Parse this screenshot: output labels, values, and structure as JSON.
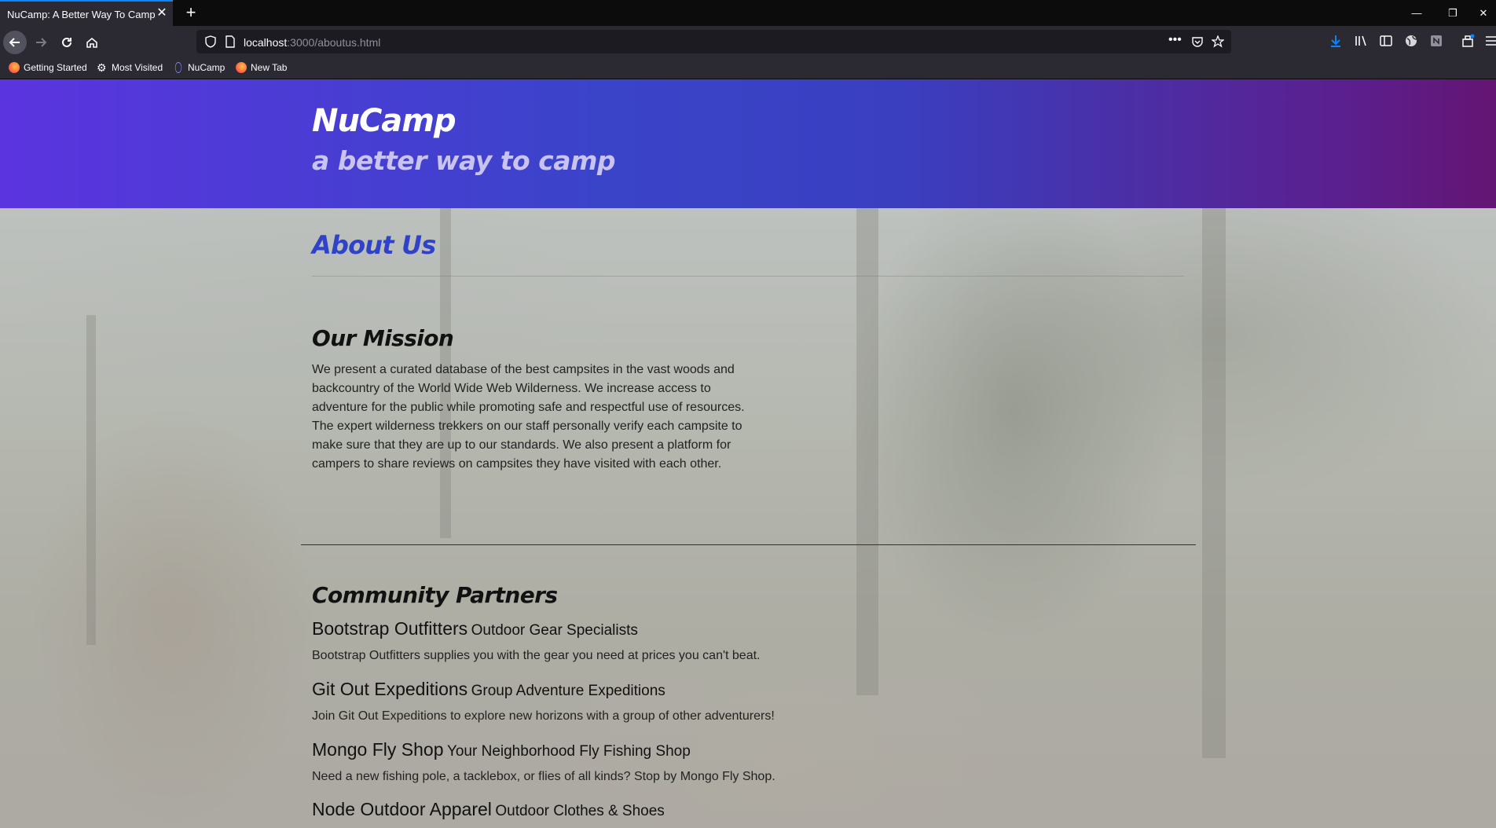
{
  "browser": {
    "tab_title": "NuCamp: A Better Way To Camp",
    "url_host": "localhost",
    "url_rest": ":3000/aboutus.html",
    "bookmarks": [
      {
        "label": "Getting Started",
        "icon": "firefox-icon"
      },
      {
        "label": "Most Visited",
        "icon": "gear-icon"
      },
      {
        "label": "NuCamp",
        "icon": "react-icon"
      },
      {
        "label": "New Tab",
        "icon": "firefox-icon"
      }
    ],
    "accent": "#0a84ff"
  },
  "header": {
    "title": "NuCamp",
    "tagline": "a better way to camp"
  },
  "page": {
    "heading": "About Us",
    "mission": {
      "title": "Our Mission",
      "text": "We present a curated database of the best campsites in the vast woods and backcountry of the World Wide Web Wilderness. We increase access to adventure for the public while promoting safe and respectful use of resources. The expert wilderness trekkers on our staff personally verify each campsite to make sure that they are up to our standards. We also present a platform for campers to share reviews on campsites they have visited with each other."
    },
    "partners": {
      "title": "Community Partners",
      "items": [
        {
          "name": "Bootstrap Outfitters",
          "tagline": "Outdoor Gear Specialists",
          "desc": "Bootstrap Outfitters supplies you with the gear you need at prices you can't beat."
        },
        {
          "name": "Git Out Expeditions",
          "tagline": "Group Adventure Expeditions",
          "desc": "Join Git Out Expeditions to explore new horizons with a group of other adventurers!"
        },
        {
          "name": "Mongo Fly Shop",
          "tagline": "Your Neighborhood Fly Fishing Shop",
          "desc": "Need a new fishing pole, a tacklebox, or flies of all kinds? Stop by Mongo Fly Shop."
        },
        {
          "name": "Node Outdoor Apparel",
          "tagline": "Outdoor Clothes & Shoes"
        }
      ]
    }
  },
  "colors": {
    "header_start": "#5b34df",
    "header_end": "#641573",
    "heading_blue": "#2f42c8"
  }
}
